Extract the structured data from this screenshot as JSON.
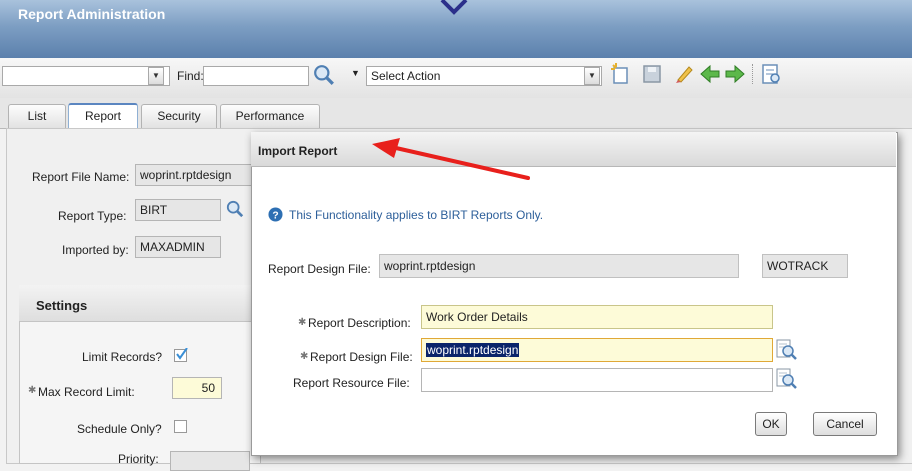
{
  "header": {
    "title": "Report Administration"
  },
  "toolbar": {
    "find_label": "Find:",
    "find_value": "",
    "select_action": "Select Action"
  },
  "tabs": [
    "List",
    "Report",
    "Security",
    "Performance"
  ],
  "form": {
    "report_file_name_label": "Report File Name:",
    "report_file_name": "woprint.rptdesign",
    "report_type_label": "Report Type:",
    "report_type": "BIRT",
    "imported_by_label": "Imported by:",
    "imported_by": "MAXADMIN"
  },
  "settings": {
    "title": "Settings",
    "limit_records_label": "Limit Records?",
    "limit_records": true,
    "max_record_limit_label": "Max Record Limit:",
    "max_record_limit": "50",
    "schedule_only_label": "Schedule Only?",
    "schedule_only": false,
    "priority_label": "Priority:"
  },
  "dialog": {
    "title": "Import Report",
    "info_text": "This Functionality applies to BIRT Reports Only.",
    "design_file_label": "Report Design File:",
    "design_file": "woprint.rptdesign",
    "app": "WOTRACK",
    "description_label": "Report Description:",
    "description": "Work Order Details",
    "design_file_input_label": "Report Design File:",
    "design_file_input": "woprint.rptdesign",
    "resource_file_label": "Report Resource File:",
    "resource_file": "",
    "ok_label": "OK",
    "cancel_label": "Cancel"
  },
  "colors": {
    "arrow": "#e8201c",
    "header": "#6d8fba",
    "required_field": "#fdfbd8",
    "info_icon": "#2d6fb3"
  }
}
